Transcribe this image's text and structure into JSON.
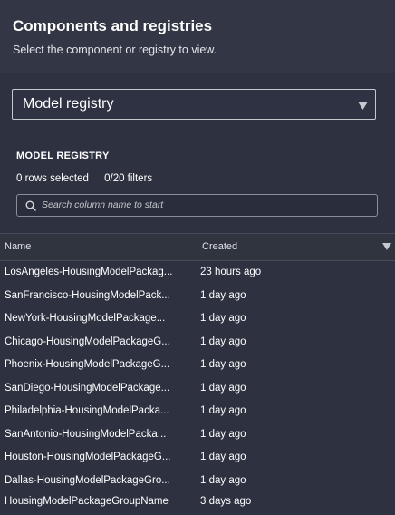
{
  "panel": {
    "title": "Components and registries",
    "subtitle": "Select the component or registry to view."
  },
  "selector": {
    "value": "Model registry"
  },
  "registry": {
    "section_title": "MODEL REGISTRY",
    "rows_selected": "0 rows selected",
    "filters": "0/20 filters",
    "search_placeholder": "Search column name to start"
  },
  "table": {
    "columns": [
      "Name",
      "Created"
    ],
    "rows": [
      {
        "name": "LosAngeles-HousingModelPackag...",
        "created": "23 hours ago"
      },
      {
        "name": "SanFrancisco-HousingModelPack...",
        "created": "1 day ago"
      },
      {
        "name": "NewYork-HousingModelPackage...",
        "created": "1 day ago"
      },
      {
        "name": "Chicago-HousingModelPackageG...",
        "created": "1 day ago"
      },
      {
        "name": "Phoenix-HousingModelPackageG...",
        "created": "1 day ago"
      },
      {
        "name": "SanDiego-HousingModelPackage...",
        "created": "1 day ago"
      },
      {
        "name": "Philadelphia-HousingModelPacka...",
        "created": "1 day ago"
      },
      {
        "name": "SanAntonio-HousingModelPacka...",
        "created": "1 day ago"
      },
      {
        "name": "Houston-HousingModelPackageG...",
        "created": "1 day ago"
      },
      {
        "name": "Dallas-HousingModelPackageGro...",
        "created": "1 day ago"
      },
      {
        "name": "HousingModelPackageGroupName",
        "created": "3 days ago"
      }
    ]
  }
}
